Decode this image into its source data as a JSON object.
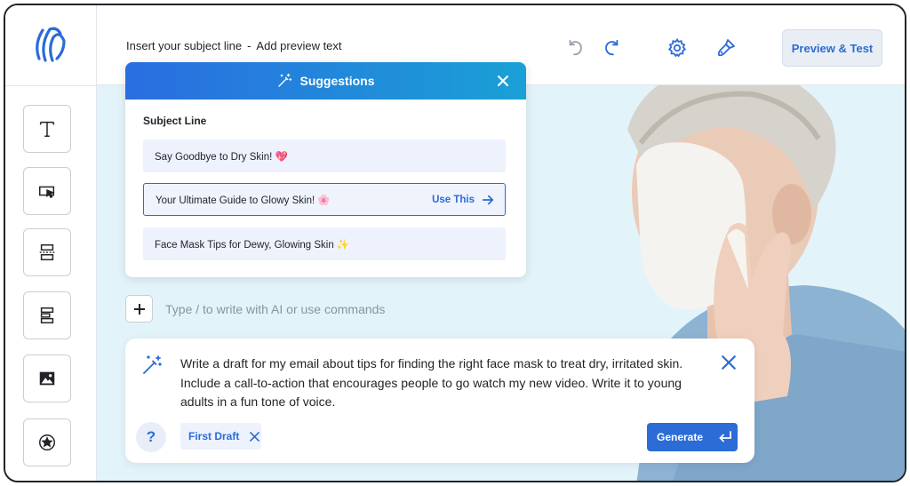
{
  "header": {
    "subject_placeholder": "Insert your subject line",
    "separator": "-",
    "preview_placeholder": "Add preview text",
    "preview_test_label": "Preview & Test"
  },
  "sidebar": {
    "tools": [
      {
        "icon": "text-icon"
      },
      {
        "icon": "button-icon"
      },
      {
        "icon": "divider-icon"
      },
      {
        "icon": "layout-icon"
      },
      {
        "icon": "image-icon"
      },
      {
        "icon": "star-icon"
      }
    ]
  },
  "suggestions": {
    "title": "Suggestions",
    "section_label": "Subject Line",
    "items": [
      {
        "text": "Say Goodbye to Dry Skin! 💖"
      },
      {
        "text": "Your Ultimate Guide to Glowy Skin! 🌸"
      },
      {
        "text": "Face Mask Tips for Dewy, Glowing Skin ✨"
      }
    ],
    "use_this_label": "Use This"
  },
  "editor": {
    "command_placeholder": "Type / to write with AI or use commands"
  },
  "ai_prompt": {
    "text": "Write a draft for my email about tips for finding the right face mask to treat dry, irritated skin. Include a call-to-action that encourages people to go watch my new video. Write it to young adults in a fun tone of voice.",
    "help_label": "?",
    "chip_label": "First Draft",
    "generate_label": "Generate"
  },
  "colors": {
    "accent": "#2b6cd6",
    "header_gradient_start": "#2a6de0",
    "header_gradient_end": "#1aa0d6",
    "canvas_bg": "#e3f3fa"
  }
}
